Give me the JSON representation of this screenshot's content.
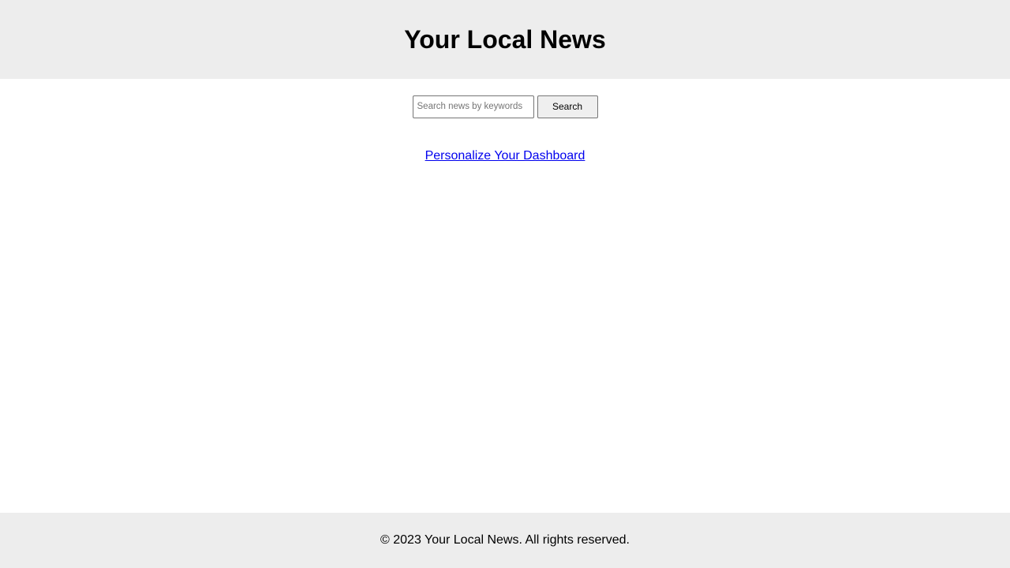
{
  "header": {
    "title": "Your Local News"
  },
  "search": {
    "placeholder": "Search news by keywords",
    "value": "",
    "button_label": "Search"
  },
  "dashboard": {
    "link_label": "Personalize Your Dashboard"
  },
  "footer": {
    "text": "© 2023 Your Local News. All rights reserved."
  },
  "colors": {
    "header_bg": "#ededed",
    "footer_bg": "#ededed",
    "link": "#0000ee"
  }
}
